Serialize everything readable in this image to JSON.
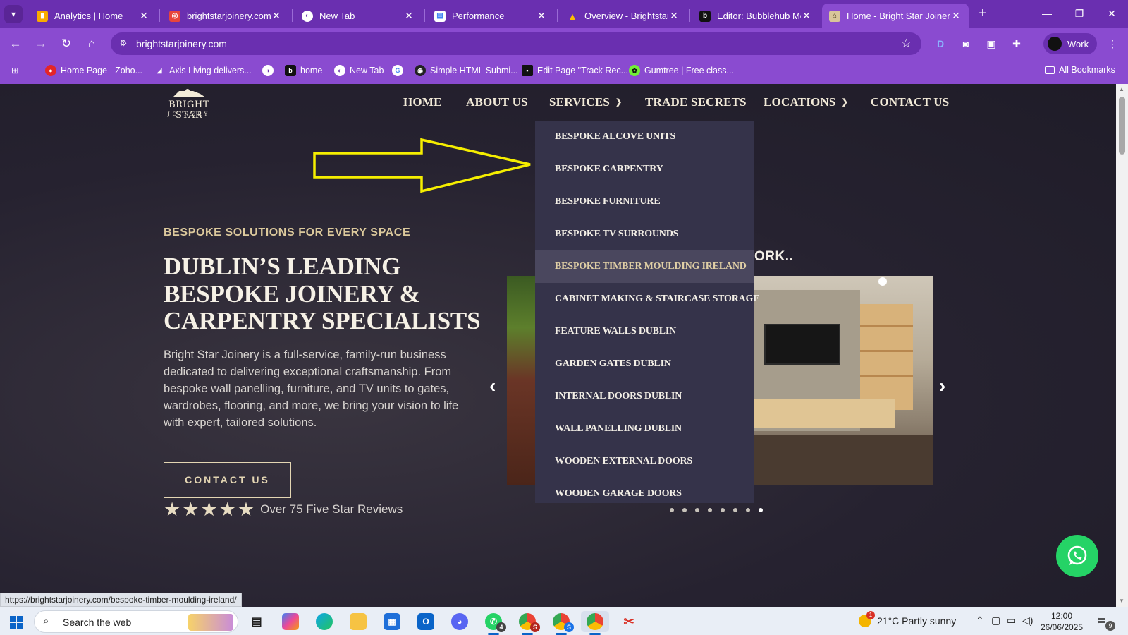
{
  "browser": {
    "tabs": [
      {
        "title": "Analytics | Home",
        "icon": "analytics-icon",
        "active": false
      },
      {
        "title": "brightstarjoinery.com: Internet",
        "icon": "seo-tool-icon",
        "active": false
      },
      {
        "title": "New Tab",
        "icon": "new-tab-icon",
        "active": false
      },
      {
        "title": "Performance",
        "icon": "performance-icon",
        "active": false
      },
      {
        "title": "Overview - Brightstar Joinery",
        "icon": "google-ads-icon",
        "active": false
      },
      {
        "title": "Editor: Bubblehub Media",
        "icon": "bubblehub-icon",
        "active": false
      },
      {
        "title": "Home - Bright Star Joinery",
        "icon": "site-favicon-icon",
        "active": true
      }
    ],
    "url": "brightstarjoinery.com",
    "profile_label": "Work",
    "bookmarks": [
      {
        "label": "Home Page - Zoho...",
        "icon": "zoho-icon"
      },
      {
        "label": "Axis Living delivers...",
        "icon": "axis-icon"
      },
      {
        "label": "",
        "icon": "globe-icon"
      },
      {
        "label": "home",
        "icon": "bubblehub-icon"
      },
      {
        "label": "New Tab",
        "icon": "new-tab-icon"
      },
      {
        "label": "",
        "icon": "google-icon"
      },
      {
        "label": "Simple HTML Submi...",
        "icon": "submit-icon"
      },
      {
        "label": "Edit Page \"Track Rec...",
        "icon": "edit-page-icon"
      },
      {
        "label": "Gumtree | Free class...",
        "icon": "gumtree-icon"
      }
    ],
    "all_bookmarks_label": "All Bookmarks",
    "status_url": "https://brightstarjoinery.com/bespoke-timber-moulding-ireland/"
  },
  "site": {
    "logo": {
      "brand": "BRIGHT STAR",
      "sub": "JOINERY"
    },
    "nav": [
      {
        "label": "HOME",
        "has_dropdown": false
      },
      {
        "label": "ABOUT US",
        "has_dropdown": false
      },
      {
        "label": "SERVICES",
        "has_dropdown": true
      },
      {
        "label": "TRADE SECRETS",
        "has_dropdown": false
      },
      {
        "label": "LOCATIONS",
        "has_dropdown": true
      },
      {
        "label": "CONTACT US",
        "has_dropdown": false
      }
    ],
    "services_menu": [
      "BESPOKE ALCOVE UNITS",
      "BESPOKE CARPENTRY",
      "BESPOKE FURNITURE",
      "BESPOKE TV SURROUNDS",
      "BESPOKE TIMBER MOULDING IRELAND",
      "CABINET MAKING & STAIRCASE STORAGE",
      "FEATURE WALLS DUBLIN",
      "GARDEN GATES DUBLIN",
      "INTERNAL DOORS DUBLIN",
      "WALL PANELLING DUBLIN",
      "WOODEN EXTERNAL DOORS",
      "WOODEN GARAGE DOORS"
    ],
    "services_menu_hovered_index": 4,
    "hero": {
      "eyebrow": "BESPOKE SOLUTIONS FOR EVERY SPACE",
      "headline": "DUBLIN’S LEADING BESPOKE JOINERY & CARPENTRY SPECIALISTS",
      "lead": "Bright Star Joinery is a full-service, family-run business dedicated to delivering exceptional craftsmanship. From bespoke wall panelling, furniture, and TV units to gates, wardrobes, flooring, and more, we bring your vision to life with expert, tailored solutions.",
      "cta": "CONTACT US",
      "rating_stars": 5,
      "reviews_text": "Over 75 Five Star Reviews"
    },
    "gallery": {
      "title_visible": "ORK..",
      "slide_count": 8,
      "active_slide_index": 7
    }
  },
  "colors": {
    "chrome_purple": "#6a2fb0",
    "toolbar_purple": "#8a4bd0",
    "gold": "#dcc99c",
    "annotation_yellow": "#f5ee00",
    "whatsapp_green": "#25d366"
  },
  "taskbar": {
    "search_placeholder": "Search the web",
    "weather": "21°C  Partly sunny",
    "weather_alert_count": "1",
    "time": "12:00",
    "date": "26/06/2025",
    "notification_count": "9",
    "whatsapp_badge": "4",
    "chrome_badge_1": "S",
    "chrome_badge_2": "S"
  }
}
